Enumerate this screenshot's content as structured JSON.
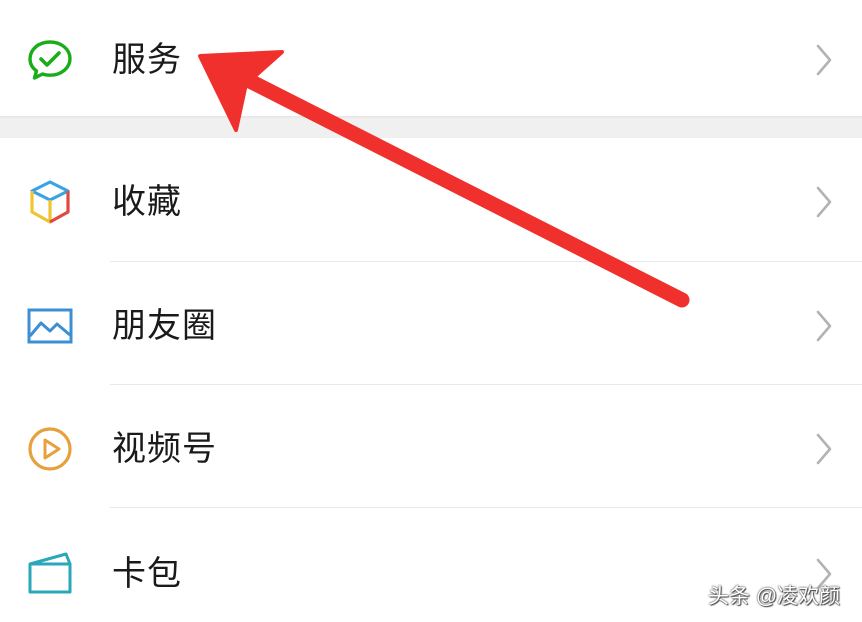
{
  "menu": {
    "items": [
      {
        "label": "服务",
        "icon": "wechat-pay-icon",
        "color": "#1aad19"
      },
      {
        "label": "收藏",
        "icon": "favorites-cube-icon",
        "colors": [
          "#3aa3e3",
          "#f0c330",
          "#e0493f"
        ]
      },
      {
        "label": "朋友圈",
        "icon": "moments-picture-icon",
        "color": "#3d8fd4"
      },
      {
        "label": "视频号",
        "icon": "channels-play-icon",
        "color": "#e8a03c"
      },
      {
        "label": "卡包",
        "icon": "card-wallet-icon",
        "color": "#2aa7b8"
      }
    ],
    "chevron_icon": "chevron-right-icon"
  },
  "annotation": {
    "arrow_color": "#f0302c",
    "arrow_target": "服务"
  },
  "watermark": {
    "text": "头条 @凌欢颜"
  }
}
